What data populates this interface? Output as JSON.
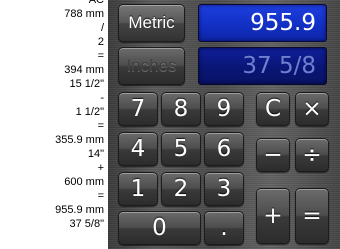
{
  "tape": {
    "lines": [
      "AC",
      "788 mm",
      "/",
      "2",
      "=",
      "394 mm",
      "15 1/2\"",
      "-",
      "1 1/2\"",
      "=",
      "355.9 mm",
      "14\"",
      "+",
      "600 mm",
      "=",
      "955.9 mm",
      "37 5/8\""
    ]
  },
  "units": {
    "metric_label": "Metric",
    "inches_label": "Inches"
  },
  "display": {
    "metric_value": "955.9",
    "inches_value": "37 5/8"
  },
  "keys": {
    "seven": "7",
    "eight": "8",
    "nine": "9",
    "clear": "C",
    "multiply": "×",
    "four": "4",
    "five": "5",
    "six": "6",
    "minus": "−",
    "divide": "÷",
    "one": "1",
    "two": "2",
    "three": "3",
    "plus": "+",
    "equals": "=",
    "zero": "0",
    "decimal": "."
  },
  "colors": {
    "metric_display": "#1230c4",
    "inches_display": "#0a1676",
    "inches_text": "#6f7fd0",
    "key_face": "#4d4d4d"
  }
}
